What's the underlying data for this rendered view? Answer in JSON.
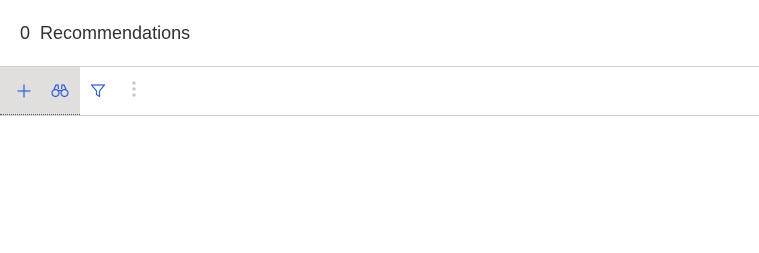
{
  "header": {
    "count": "0",
    "title": "Recommendations"
  },
  "toolbar": {
    "buttons": [
      {
        "name": "add",
        "icon": "plus-icon"
      },
      {
        "name": "search",
        "icon": "binoculars-icon"
      },
      {
        "name": "filter",
        "icon": "filter-icon"
      },
      {
        "name": "more",
        "icon": "more-vertical-icon"
      }
    ]
  },
  "colors": {
    "icon_accent": "#2f5fdf",
    "muted_icon": "#c8c6c4",
    "active_group_bg": "#e1dfdd",
    "divider": "#d2d0ce",
    "text": "#323130"
  }
}
